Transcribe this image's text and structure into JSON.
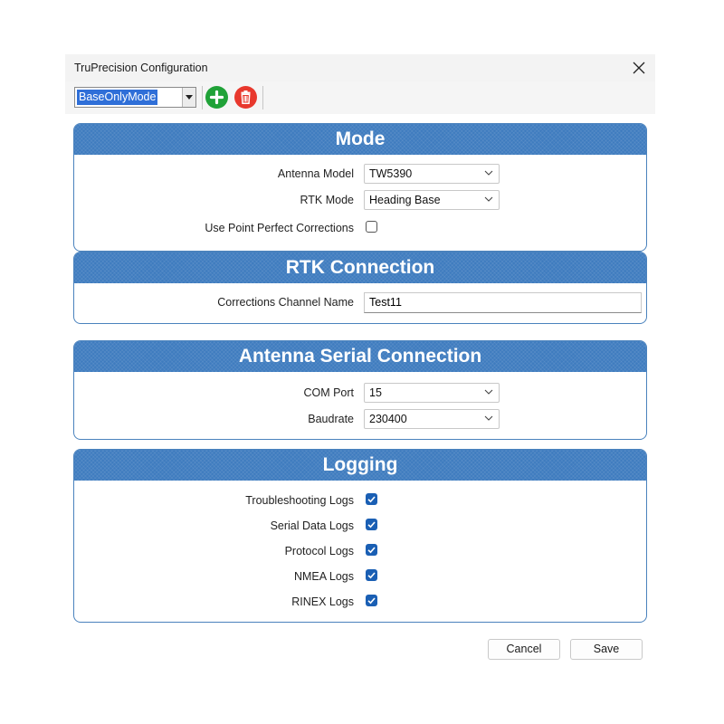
{
  "window": {
    "title": "TruPrecision Configuration"
  },
  "toolbar": {
    "profile_value": "BaseOnlyMode"
  },
  "mode": {
    "heading": "Mode",
    "antenna_model": {
      "label": "Antenna Model",
      "value": "TW5390"
    },
    "rtk_mode": {
      "label": "RTK Mode",
      "value": "Heading Base"
    },
    "point_perfect": {
      "label": "Use Point Perfect Corrections",
      "checked": false
    }
  },
  "rtk_connection": {
    "heading": "RTK Connection",
    "channel_name": {
      "label": "Corrections Channel Name",
      "value": "Test11"
    }
  },
  "antenna_serial": {
    "heading": "Antenna Serial Connection",
    "com_port": {
      "label": "COM Port",
      "value": "15"
    },
    "baudrate": {
      "label": "Baudrate",
      "value": "230400"
    }
  },
  "logging": {
    "heading": "Logging",
    "items": [
      {
        "label": "Troubleshooting Logs",
        "checked": true
      },
      {
        "label": "Serial Data Logs",
        "checked": true
      },
      {
        "label": "Protocol Logs",
        "checked": true
      },
      {
        "label": "NMEA Logs",
        "checked": true
      },
      {
        "label": "RINEX Logs",
        "checked": true
      }
    ]
  },
  "footer": {
    "cancel_label": "Cancel",
    "save_label": "Save"
  },
  "colors": {
    "section_header": "#3f7cbf",
    "section_border": "#4a82bd",
    "checkbox_checked": "#1a5fb4",
    "add_button": "#20a238",
    "delete_button": "#e8382d",
    "selection": "#2f6fd8"
  },
  "icons": {
    "close": "close-icon",
    "add": "plus-icon",
    "delete": "trash-icon",
    "dropdown": "chevron-down-icon",
    "check": "check-icon"
  }
}
